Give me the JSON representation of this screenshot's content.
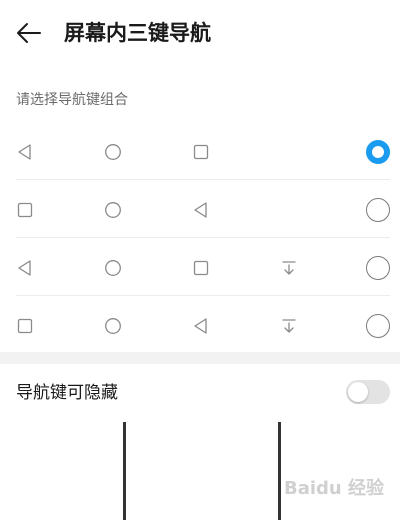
{
  "header": {
    "title": "屏幕内三键导航",
    "back_icon": "arrow-left-icon"
  },
  "section": {
    "label": "请选择导航键组合"
  },
  "options": [
    {
      "icons": [
        "back-triangle-icon",
        "home-circle-icon",
        "recents-square-icon"
      ],
      "selected": true
    },
    {
      "icons": [
        "recents-square-icon",
        "home-circle-icon",
        "back-triangle-icon"
      ],
      "selected": false
    },
    {
      "icons": [
        "back-triangle-icon",
        "home-circle-icon",
        "recents-square-icon",
        "notification-pulldown-icon"
      ],
      "selected": false
    },
    {
      "icons": [
        "recents-square-icon",
        "home-circle-icon",
        "back-triangle-icon",
        "notification-pulldown-icon"
      ],
      "selected": false
    }
  ],
  "hide_toggle": {
    "label": "导航键可隐藏",
    "enabled": false
  },
  "watermark": {
    "text": "Baidu 经验"
  },
  "colors": {
    "accent": "#1a9bf0",
    "icon": "#8a8a8a",
    "divider": "#ececec",
    "section_gap": "#f2f2f2",
    "toggle_off": "#e3e3e3"
  }
}
